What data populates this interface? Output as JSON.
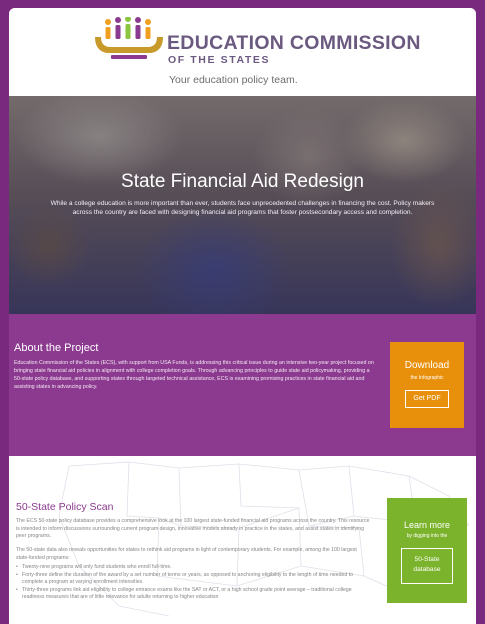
{
  "header": {
    "org_name": "EDUCATION COMMISSION",
    "org_sub": "OF THE STATES",
    "tagline": "Your education policy team."
  },
  "hero": {
    "title": "State Financial Aid Redesign",
    "text": "While a college education is more important than ever, students face unprecedented challenges in financing the cost. Policy makers across the country are faced with designing financial aid programs that foster postsecondary access and completion."
  },
  "about": {
    "title": "About the Project",
    "text": "Education Commission of the States (ECS), with support from USA Funds, is addressing this critical issue during an intensive two-year project focused on bringing state financial aid policies in alignment with college completion goals. Through advancing principles to guide state aid policymaking, providing a 50-state policy database, and supporting states through targeted technical assistance, ECS is examining promising practices in state financial aid and assisting states in advancing policy.",
    "download": {
      "title": "Download",
      "subtitle": "the Infographic",
      "button": "Get PDF"
    }
  },
  "scan": {
    "title": "50-State Policy Scan",
    "intro": "The ECS 50-state policy database provides a comprehensive look at the 100 largest state-funded financial aid programs across the country. This resource is intended to inform discussions surrounding current program design, innovative models already in practice in the states, and assist states in identifying peer programs.",
    "para2": "The 50-state data also reveals opportunities for states to rethink aid programs in light of contemporary students. For example, among the 100 largest state-funded programs:",
    "bullets": [
      "Twenty-nine programs will only fund students who enroll full-time.",
      "Forty-three define the duration of the award by a set number of terms or years, as opposed to anchoring eligibility to the length of time needed to complete a program at varying enrollment intensities.",
      "Thirty-three programs link aid eligibility to college entrance exams like the SAT or ACT, or a high school grade point average – traditional college readiness measures that are of little relevance for adults returning to higher education"
    ],
    "learn": {
      "title": "Learn more",
      "subtitle": "by digging into the",
      "button_line1": "50-State",
      "button_line2": "database"
    }
  },
  "colors": {
    "page_bg": "#7a2a7e",
    "about_bg": "#8b3a8f",
    "download_bg": "#e8900c",
    "learn_bg": "#7cb32c",
    "logo_orange": "#f0a020",
    "logo_purple": "#8b3a8f",
    "logo_green": "#8cc63f",
    "logo_gold": "#c89a2a"
  }
}
